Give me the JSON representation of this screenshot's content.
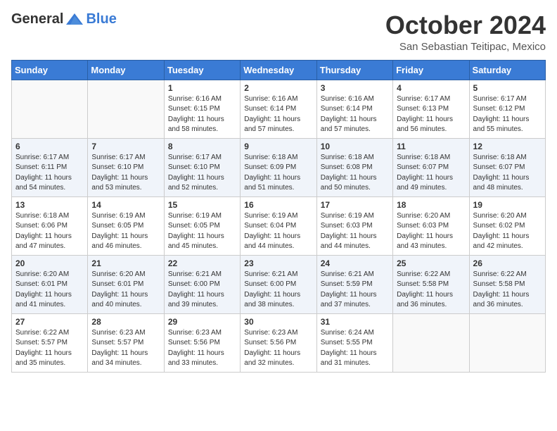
{
  "header": {
    "logo_general": "General",
    "logo_blue": "Blue",
    "month_title": "October 2024",
    "location": "San Sebastian Teitipac, Mexico"
  },
  "days_of_week": [
    "Sunday",
    "Monday",
    "Tuesday",
    "Wednesday",
    "Thursday",
    "Friday",
    "Saturday"
  ],
  "weeks": [
    [
      {
        "day": "",
        "info": ""
      },
      {
        "day": "",
        "info": ""
      },
      {
        "day": "1",
        "info": "Sunrise: 6:16 AM\nSunset: 6:15 PM\nDaylight: 11 hours and 58 minutes."
      },
      {
        "day": "2",
        "info": "Sunrise: 6:16 AM\nSunset: 6:14 PM\nDaylight: 11 hours and 57 minutes."
      },
      {
        "day": "3",
        "info": "Sunrise: 6:16 AM\nSunset: 6:14 PM\nDaylight: 11 hours and 57 minutes."
      },
      {
        "day": "4",
        "info": "Sunrise: 6:17 AM\nSunset: 6:13 PM\nDaylight: 11 hours and 56 minutes."
      },
      {
        "day": "5",
        "info": "Sunrise: 6:17 AM\nSunset: 6:12 PM\nDaylight: 11 hours and 55 minutes."
      }
    ],
    [
      {
        "day": "6",
        "info": "Sunrise: 6:17 AM\nSunset: 6:11 PM\nDaylight: 11 hours and 54 minutes."
      },
      {
        "day": "7",
        "info": "Sunrise: 6:17 AM\nSunset: 6:10 PM\nDaylight: 11 hours and 53 minutes."
      },
      {
        "day": "8",
        "info": "Sunrise: 6:17 AM\nSunset: 6:10 PM\nDaylight: 11 hours and 52 minutes."
      },
      {
        "day": "9",
        "info": "Sunrise: 6:18 AM\nSunset: 6:09 PM\nDaylight: 11 hours and 51 minutes."
      },
      {
        "day": "10",
        "info": "Sunrise: 6:18 AM\nSunset: 6:08 PM\nDaylight: 11 hours and 50 minutes."
      },
      {
        "day": "11",
        "info": "Sunrise: 6:18 AM\nSunset: 6:07 PM\nDaylight: 11 hours and 49 minutes."
      },
      {
        "day": "12",
        "info": "Sunrise: 6:18 AM\nSunset: 6:07 PM\nDaylight: 11 hours and 48 minutes."
      }
    ],
    [
      {
        "day": "13",
        "info": "Sunrise: 6:18 AM\nSunset: 6:06 PM\nDaylight: 11 hours and 47 minutes."
      },
      {
        "day": "14",
        "info": "Sunrise: 6:19 AM\nSunset: 6:05 PM\nDaylight: 11 hours and 46 minutes."
      },
      {
        "day": "15",
        "info": "Sunrise: 6:19 AM\nSunset: 6:05 PM\nDaylight: 11 hours and 45 minutes."
      },
      {
        "day": "16",
        "info": "Sunrise: 6:19 AM\nSunset: 6:04 PM\nDaylight: 11 hours and 44 minutes."
      },
      {
        "day": "17",
        "info": "Sunrise: 6:19 AM\nSunset: 6:03 PM\nDaylight: 11 hours and 44 minutes."
      },
      {
        "day": "18",
        "info": "Sunrise: 6:20 AM\nSunset: 6:03 PM\nDaylight: 11 hours and 43 minutes."
      },
      {
        "day": "19",
        "info": "Sunrise: 6:20 AM\nSunset: 6:02 PM\nDaylight: 11 hours and 42 minutes."
      }
    ],
    [
      {
        "day": "20",
        "info": "Sunrise: 6:20 AM\nSunset: 6:01 PM\nDaylight: 11 hours and 41 minutes."
      },
      {
        "day": "21",
        "info": "Sunrise: 6:20 AM\nSunset: 6:01 PM\nDaylight: 11 hours and 40 minutes."
      },
      {
        "day": "22",
        "info": "Sunrise: 6:21 AM\nSunset: 6:00 PM\nDaylight: 11 hours and 39 minutes."
      },
      {
        "day": "23",
        "info": "Sunrise: 6:21 AM\nSunset: 6:00 PM\nDaylight: 11 hours and 38 minutes."
      },
      {
        "day": "24",
        "info": "Sunrise: 6:21 AM\nSunset: 5:59 PM\nDaylight: 11 hours and 37 minutes."
      },
      {
        "day": "25",
        "info": "Sunrise: 6:22 AM\nSunset: 5:58 PM\nDaylight: 11 hours and 36 minutes."
      },
      {
        "day": "26",
        "info": "Sunrise: 6:22 AM\nSunset: 5:58 PM\nDaylight: 11 hours and 36 minutes."
      }
    ],
    [
      {
        "day": "27",
        "info": "Sunrise: 6:22 AM\nSunset: 5:57 PM\nDaylight: 11 hours and 35 minutes."
      },
      {
        "day": "28",
        "info": "Sunrise: 6:23 AM\nSunset: 5:57 PM\nDaylight: 11 hours and 34 minutes."
      },
      {
        "day": "29",
        "info": "Sunrise: 6:23 AM\nSunset: 5:56 PM\nDaylight: 11 hours and 33 minutes."
      },
      {
        "day": "30",
        "info": "Sunrise: 6:23 AM\nSunset: 5:56 PM\nDaylight: 11 hours and 32 minutes."
      },
      {
        "day": "31",
        "info": "Sunrise: 6:24 AM\nSunset: 5:55 PM\nDaylight: 11 hours and 31 minutes."
      },
      {
        "day": "",
        "info": ""
      },
      {
        "day": "",
        "info": ""
      }
    ]
  ]
}
